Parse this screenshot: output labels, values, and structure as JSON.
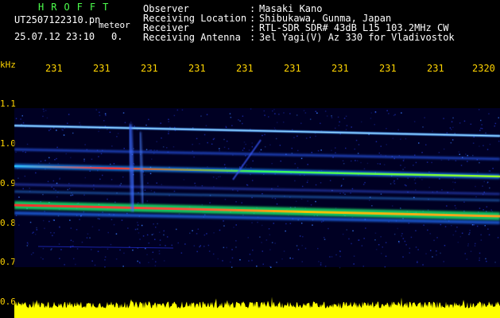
{
  "header": {
    "logo": "HROFFT",
    "filename": "UT2507122310.pn",
    "meteor_label": "meteor",
    "datetime": "25.07.12 23:10",
    "counter": "0.",
    "fields": [
      {
        "label": "Observer",
        "value": "Masaki Kano"
      },
      {
        "label": "Receiving Location",
        "value": "Shibukawa, Gunma, Japan"
      },
      {
        "label": "Receiver",
        "value": "RTL-SDR SDR# 43dB L15 103.2MHz CW"
      },
      {
        "label": "Receiving Antenna",
        "value": "3el Yagi(V) Az 330 for Vladivostok"
      }
    ]
  },
  "axes": {
    "y_unit": "kHz",
    "y_ticks": [
      "1.1",
      "1.0",
      "0.9",
      "0.8",
      "0.7",
      "0.6"
    ],
    "x_ticks": [
      "231",
      "231",
      "231",
      "231",
      "231",
      "231",
      "231",
      "231",
      "231",
      "2320"
    ]
  },
  "colors": {
    "background": "#000000",
    "axis_text": "#ffd400",
    "header_text": "#ffffff",
    "logo": "#4cff4c",
    "noise_floor": "#ffff00"
  }
}
